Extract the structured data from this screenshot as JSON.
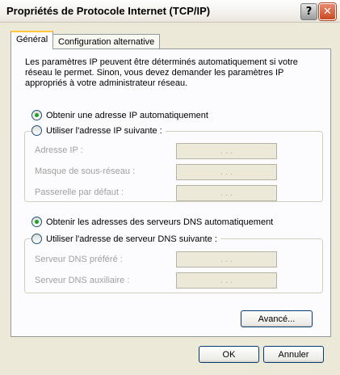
{
  "window": {
    "title": "Propriétés de Protocole Internet (TCP/IP)",
    "help_glyph": "?",
    "close_glyph": "✕"
  },
  "tabs": [
    {
      "label": "Général",
      "active": true
    },
    {
      "label": "Configuration alternative",
      "active": false
    }
  ],
  "description": "Les paramètres IP peuvent être déterminés automatiquement si votre réseau le permet. Sinon, vous devez demander les paramètres IP appropriés à votre administrateur réseau.",
  "ip": {
    "auto_label": "Obtenir une adresse IP automatiquement",
    "manual_label": "Utiliser l'adresse IP suivante :",
    "selected": "auto",
    "fields": [
      {
        "label": "Adresse IP :",
        "value": ". . ."
      },
      {
        "label": "Masque de sous-réseau :",
        "value": ". . ."
      },
      {
        "label": "Passerelle par défaut :",
        "value": ". . ."
      }
    ]
  },
  "dns": {
    "auto_label": "Obtenir les adresses des serveurs DNS automatiquement",
    "manual_label": "Utiliser l'adresse de serveur DNS suivante :",
    "selected": "auto",
    "fields": [
      {
        "label": "Serveur DNS préféré :",
        "value": ". . ."
      },
      {
        "label": "Serveur DNS auxiliaire :",
        "value": ". . ."
      }
    ]
  },
  "buttons": {
    "advanced": "Avancé...",
    "ok": "OK",
    "cancel": "Annuler"
  }
}
